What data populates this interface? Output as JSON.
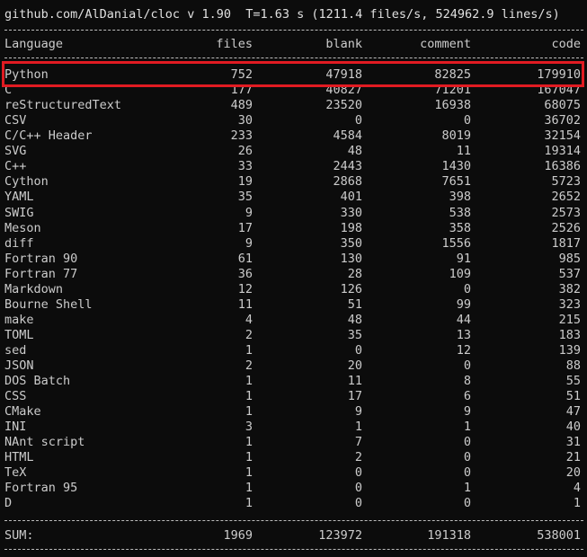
{
  "header": "github.com/AlDanial/cloc v 1.90  T=1.63 s (1211.4 files/s, 524962.9 lines/s)",
  "columns": {
    "language": "Language",
    "files": "files",
    "blank": "blank",
    "comment": "comment",
    "code": "code"
  },
  "rows": [
    {
      "language": "Python",
      "files": "752",
      "blank": "47918",
      "comment": "82825",
      "code": "179910"
    },
    {
      "language": "C",
      "files": "177",
      "blank": "40827",
      "comment": "71201",
      "code": "167047"
    },
    {
      "language": "reStructuredText",
      "files": "489",
      "blank": "23520",
      "comment": "16938",
      "code": "68075"
    },
    {
      "language": "CSV",
      "files": "30",
      "blank": "0",
      "comment": "0",
      "code": "36702"
    },
    {
      "language": "C/C++ Header",
      "files": "233",
      "blank": "4584",
      "comment": "8019",
      "code": "32154"
    },
    {
      "language": "SVG",
      "files": "26",
      "blank": "48",
      "comment": "11",
      "code": "19314"
    },
    {
      "language": "C++",
      "files": "33",
      "blank": "2443",
      "comment": "1430",
      "code": "16386"
    },
    {
      "language": "Cython",
      "files": "19",
      "blank": "2868",
      "comment": "7651",
      "code": "5723"
    },
    {
      "language": "YAML",
      "files": "35",
      "blank": "401",
      "comment": "398",
      "code": "2652"
    },
    {
      "language": "SWIG",
      "files": "9",
      "blank": "330",
      "comment": "538",
      "code": "2573"
    },
    {
      "language": "Meson",
      "files": "17",
      "blank": "198",
      "comment": "358",
      "code": "2526"
    },
    {
      "language": "diff",
      "files": "9",
      "blank": "350",
      "comment": "1556",
      "code": "1817"
    },
    {
      "language": "Fortran 90",
      "files": "61",
      "blank": "130",
      "comment": "91",
      "code": "985"
    },
    {
      "language": "Fortran 77",
      "files": "36",
      "blank": "28",
      "comment": "109",
      "code": "537"
    },
    {
      "language": "Markdown",
      "files": "12",
      "blank": "126",
      "comment": "0",
      "code": "382"
    },
    {
      "language": "Bourne Shell",
      "files": "11",
      "blank": "51",
      "comment": "99",
      "code": "323"
    },
    {
      "language": "make",
      "files": "4",
      "blank": "48",
      "comment": "44",
      "code": "215"
    },
    {
      "language": "TOML",
      "files": "2",
      "blank": "35",
      "comment": "13",
      "code": "183"
    },
    {
      "language": "sed",
      "files": "1",
      "blank": "0",
      "comment": "12",
      "code": "139"
    },
    {
      "language": "JSON",
      "files": "2",
      "blank": "20",
      "comment": "0",
      "code": "88"
    },
    {
      "language": "DOS Batch",
      "files": "1",
      "blank": "11",
      "comment": "8",
      "code": "55"
    },
    {
      "language": "CSS",
      "files": "1",
      "blank": "17",
      "comment": "6",
      "code": "51"
    },
    {
      "language": "CMake",
      "files": "1",
      "blank": "9",
      "comment": "9",
      "code": "47"
    },
    {
      "language": "INI",
      "files": "3",
      "blank": "1",
      "comment": "1",
      "code": "40"
    },
    {
      "language": "NAnt script",
      "files": "1",
      "blank": "7",
      "comment": "0",
      "code": "31"
    },
    {
      "language": "HTML",
      "files": "1",
      "blank": "2",
      "comment": "0",
      "code": "21"
    },
    {
      "language": "TeX",
      "files": "1",
      "blank": "0",
      "comment": "0",
      "code": "20"
    },
    {
      "language": "Fortran 95",
      "files": "1",
      "blank": "0",
      "comment": "1",
      "code": "4"
    },
    {
      "language": "D",
      "files": "1",
      "blank": "0",
      "comment": "0",
      "code": "1"
    }
  ],
  "sum": {
    "language": "SUM:",
    "files": "1969",
    "blank": "123972",
    "comment": "191318",
    "code": "538001"
  },
  "colors": {
    "background": "#0c0c0c",
    "text": "#cccccc",
    "highlight_border": "#e11b22"
  }
}
